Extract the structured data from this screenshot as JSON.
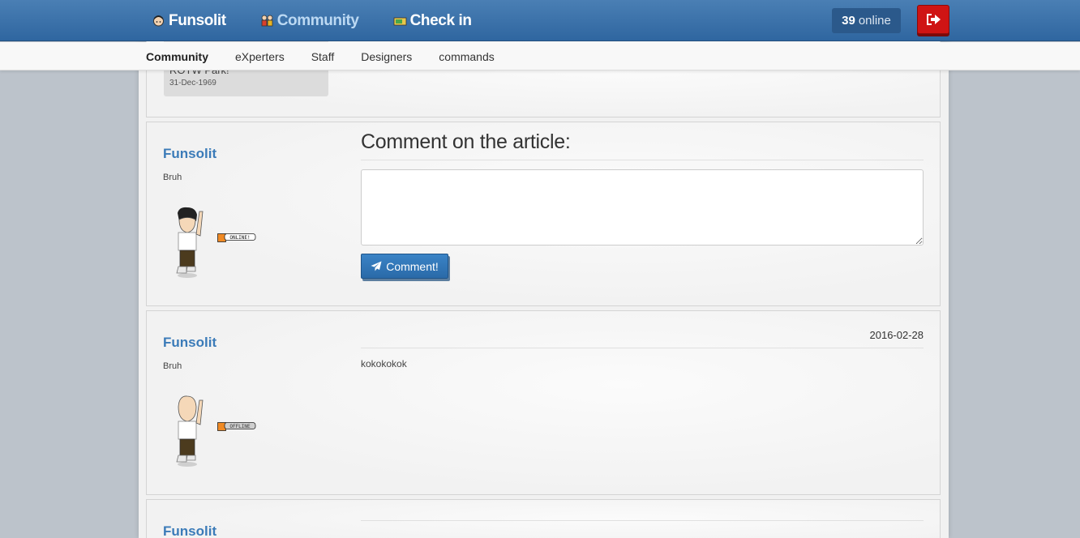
{
  "nav": {
    "items": [
      {
        "label": "Funsolit",
        "icon": "avatar-head-icon"
      },
      {
        "label": "Community",
        "icon": "community-icon"
      },
      {
        "label": "Check in",
        "icon": "ticket-icon"
      }
    ],
    "online_count": "39",
    "online_label": "online",
    "logout_icon": "logout-icon",
    "colors": {
      "bar": "#3a72ab",
      "logout": "#cf1414",
      "active_nav": "#bcd9f3"
    }
  },
  "subnav": {
    "items": [
      "Community",
      "eXperters",
      "Staff",
      "Designers",
      "commands"
    ],
    "active": "Community"
  },
  "news_card": {
    "title": "ROTW Park!",
    "date": "31-Dec-1969"
  },
  "comment_form": {
    "user": {
      "name": "Funsolit",
      "motto": "Bruh",
      "status": "ONLINE!"
    },
    "heading": "Comment on the article:",
    "input_value": "",
    "button_label": "Comment!",
    "button_icon": "paper-plane-icon"
  },
  "comments": [
    {
      "user": {
        "name": "Funsolit",
        "motto": "Bruh",
        "status": "OFFLINE"
      },
      "date": "2016-02-28",
      "text": "kokokokok"
    },
    {
      "user": {
        "name": "Funsolit"
      }
    }
  ]
}
